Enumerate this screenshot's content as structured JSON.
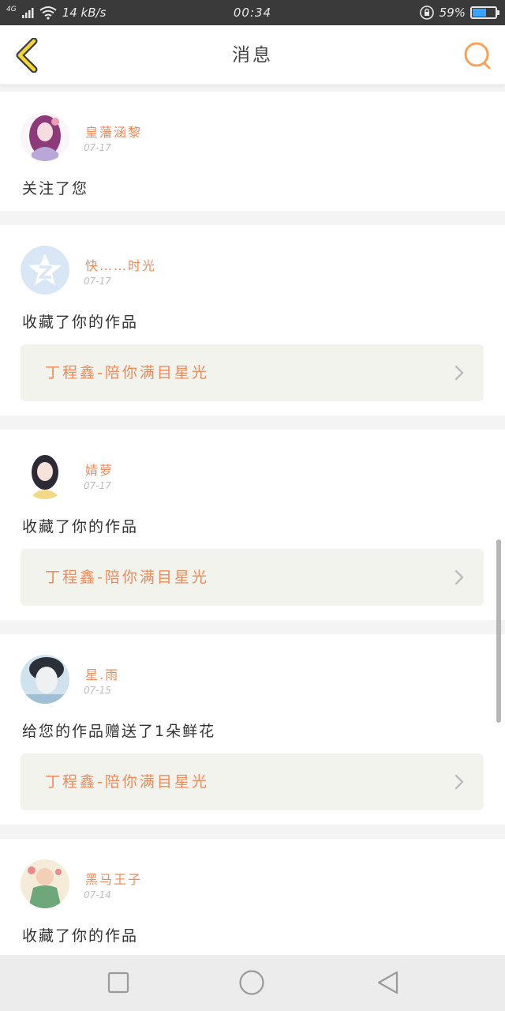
{
  "status_bar": {
    "network": "4G",
    "speed": "14 kB/s",
    "time": "00:34",
    "battery": "59%",
    "battery_level": 0.59
  },
  "header": {
    "title": "消息",
    "back_icon": "chevron-left-icon",
    "search_icon": "search-icon",
    "accent_color": "#f5a25d"
  },
  "feed": [
    {
      "name": "皇藩涵黎",
      "date": "07-17",
      "action": "关注了您"
    },
    {
      "name": "快……时光",
      "date": "07-17",
      "action": "收藏了你的作品",
      "work": "丁程鑫-陪你满目星光"
    },
    {
      "name": "婧萝",
      "date": "07-17",
      "action": "收藏了你的作品",
      "work": "丁程鑫-陪你满目星光"
    },
    {
      "name": "星.雨",
      "date": "07-15",
      "action": "给您的作品赠送了1朵鲜花",
      "work": "丁程鑫-陪你满目星光"
    },
    {
      "name": "黑马王子",
      "date": "07-14",
      "action": "收藏了你的作品"
    }
  ],
  "colors": {
    "name": "#f08a5a",
    "card_bg": "#ffffff",
    "work_bg": "#f3f3ee"
  },
  "nav": {
    "recents_icon": "square-icon",
    "home_icon": "circle-icon",
    "back_icon": "triangle-back-icon"
  }
}
